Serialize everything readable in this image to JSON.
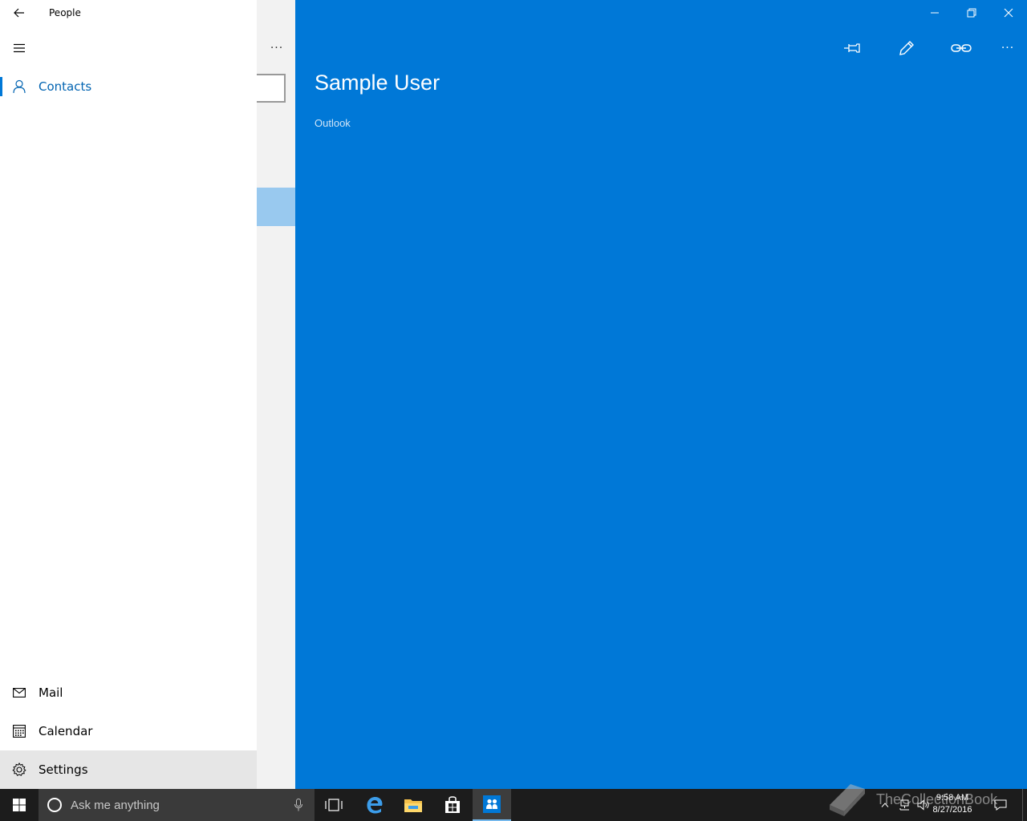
{
  "app": {
    "title": "People"
  },
  "nav": {
    "items": [
      {
        "label": "Contacts",
        "icon": "person-icon",
        "active": true
      }
    ],
    "bottom_items": [
      {
        "label": "Mail",
        "icon": "mail-icon"
      },
      {
        "label": "Calendar",
        "icon": "calendar-icon"
      },
      {
        "label": "Settings",
        "icon": "gear-icon"
      }
    ]
  },
  "list": {
    "more_label": "···"
  },
  "detail": {
    "name": "Sample User",
    "source": "Outlook",
    "commands": [
      "pin-icon",
      "edit-icon",
      "link-icon",
      "more-icon"
    ],
    "more_label": "···"
  },
  "taskbar": {
    "search_placeholder": "Ask me anything",
    "time": "9:58 AM",
    "date": "8/27/2016",
    "watermark": "TheCollectionBook"
  },
  "colors": {
    "accent": "#0078d7",
    "nav_bg": "#ffffff",
    "list_bg": "#f2f2f2",
    "selected_list_item": "#99c9ef",
    "taskbar": "#1c1c1c"
  }
}
